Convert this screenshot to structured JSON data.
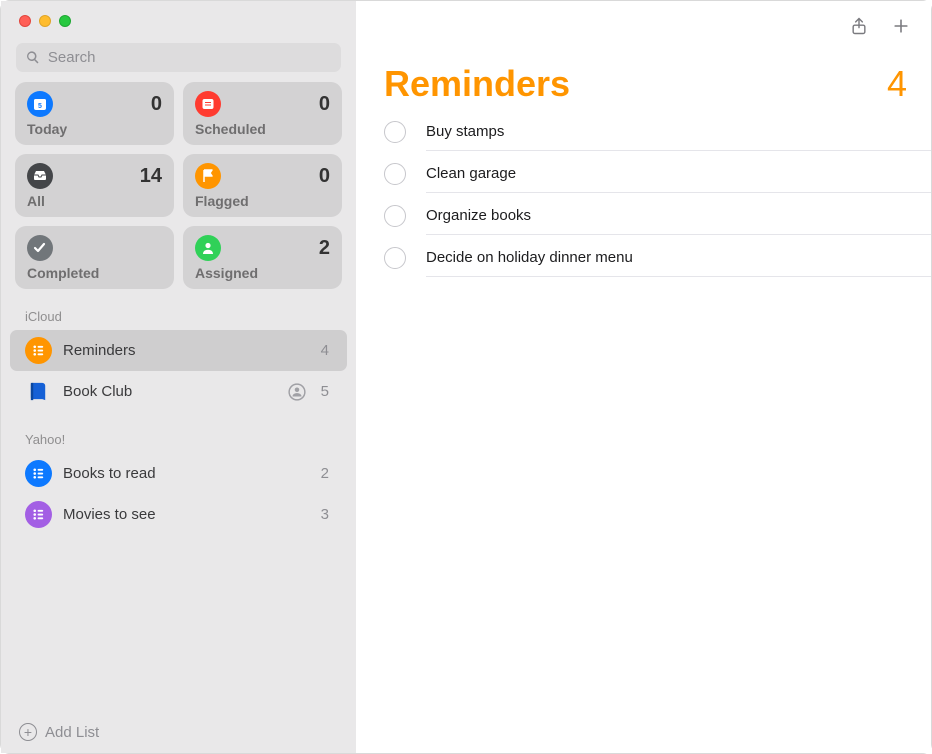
{
  "window": {
    "search_placeholder": "Search"
  },
  "smart": {
    "today": {
      "label": "Today",
      "count": 0,
      "color": "#0d79ff"
    },
    "scheduled": {
      "label": "Scheduled",
      "count": 0,
      "color": "#ff3b30"
    },
    "all": {
      "label": "All",
      "count": 14,
      "color": "#444649"
    },
    "flagged": {
      "label": "Flagged",
      "count": 0,
      "color": "#ff9500"
    },
    "completed": {
      "label": "Completed",
      "count": "",
      "color": "#71767a"
    },
    "assigned": {
      "label": "Assigned",
      "count": 2,
      "color": "#30d158"
    }
  },
  "sections": [
    {
      "name": "iCloud",
      "lists": [
        {
          "name": "Reminders",
          "count": 4,
          "color": "#ff9500",
          "shared": false,
          "selected": true,
          "icon": "bullets"
        },
        {
          "name": "Book Club",
          "count": 5,
          "color": "#1560d6",
          "shared": true,
          "selected": false,
          "icon": "book"
        }
      ]
    },
    {
      "name": "Yahoo!",
      "lists": [
        {
          "name": "Books to read",
          "count": 2,
          "color": "#0d79ff",
          "shared": false,
          "selected": false,
          "icon": "bullets"
        },
        {
          "name": "Movies to see",
          "count": 3,
          "color": "#a35fe4",
          "shared": false,
          "selected": false,
          "icon": "bullets"
        }
      ]
    }
  ],
  "footer": {
    "add_list_label": "Add List"
  },
  "main": {
    "title": "Reminders",
    "count": 4,
    "items": [
      "Buy stamps",
      "Clean garage",
      "Organize books",
      "Decide on holiday dinner menu"
    ]
  },
  "icons": {
    "share_name": "share-icon",
    "add_name": "plus-icon"
  }
}
